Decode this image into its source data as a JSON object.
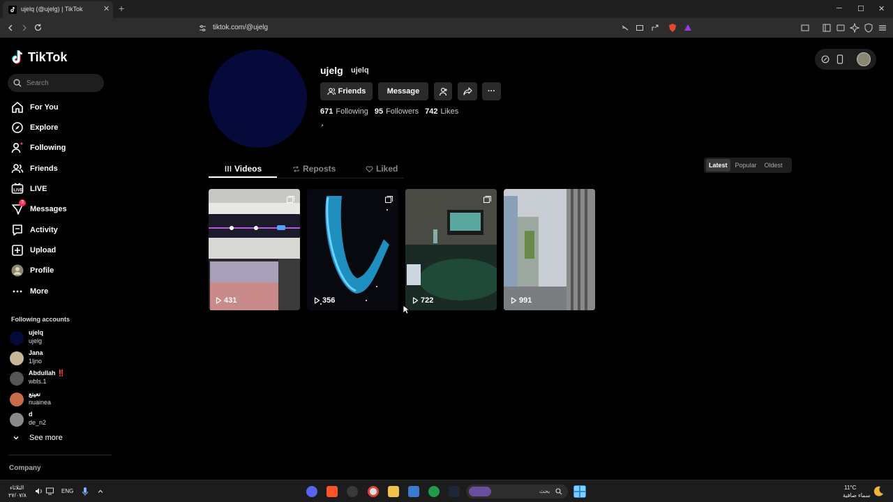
{
  "browser": {
    "tab_title": "ujelq (@ujelg) | TikTok",
    "tab_close": "✕",
    "new_tab": "+",
    "url": "tiktok.com/@ujelg",
    "win_min": "─",
    "win_max": "☐",
    "win_close": "✕"
  },
  "sidebar": {
    "logo_text": "TikTok",
    "search_placeholder": "Search",
    "nav": [
      {
        "label": "For You",
        "icon": "home-icon"
      },
      {
        "label": "Explore",
        "icon": "compass-icon"
      },
      {
        "label": "Following",
        "icon": "following-icon"
      },
      {
        "label": "Friends",
        "icon": "friends-icon"
      },
      {
        "label": "LIVE",
        "icon": "live-icon"
      },
      {
        "label": "Messages",
        "icon": "messages-icon",
        "badge": "3"
      },
      {
        "label": "Activity",
        "icon": "activity-icon"
      },
      {
        "label": "Upload",
        "icon": "upload-icon"
      },
      {
        "label": "Profile",
        "icon": "avatar"
      },
      {
        "label": "More",
        "icon": "more-icon"
      }
    ],
    "following_title": "Following accounts",
    "accounts": [
      {
        "name": "ujelq",
        "handle": "ujelg",
        "color": "#060a3a"
      },
      {
        "name": "Jana",
        "handle": "1ljno",
        "color": "#c9b79a"
      },
      {
        "name": "Abdullah ‼️",
        "handle": "wbls.1",
        "color": "#555555"
      },
      {
        "name": "نعينع",
        "handle": "nuainea",
        "color": "#c96a4a"
      },
      {
        "name": "d",
        "handle": "de_n2",
        "color": "#8a8a8a"
      }
    ],
    "see_more": "See more",
    "company": "Company"
  },
  "profile": {
    "username": "ujelg",
    "nickname": "ujelq",
    "buttons": {
      "friends": "Friends",
      "message": "Message",
      "more": "···"
    },
    "following_count": "671",
    "following_label": "Following",
    "followers_count": "95",
    "followers_label": "Followers",
    "likes_count": "742",
    "likes_label": "Likes",
    "bio": "ُ"
  },
  "tabs": {
    "videos": "Videos",
    "reposts": "Reposts",
    "liked": "Liked"
  },
  "sort": {
    "latest": "Latest",
    "popular": "Popular",
    "oldest": "Oldest"
  },
  "videos": [
    {
      "views": "431",
      "multi_image": true
    },
    {
      "views": "356",
      "multi_image": true
    },
    {
      "views": "722",
      "multi_image": true
    },
    {
      "views": "991",
      "multi_image": false
    }
  ],
  "taskbar": {
    "time": "الثلاثاء",
    "date": "٢٧/٠٧/٨",
    "lang": "ENG",
    "search_placeholder": "بحث",
    "weather_temp": "11°C",
    "weather_desc": "سماء صافية"
  }
}
